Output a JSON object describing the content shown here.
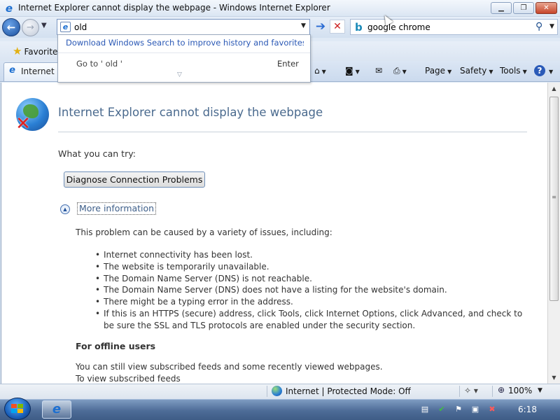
{
  "window": {
    "title": "Internet Explorer cannot display the webpage - Windows Internet Explorer",
    "min_glyph": "▁",
    "max_glyph": "❐",
    "close_glyph": "✕"
  },
  "navigation": {
    "back_glyph": "←",
    "forward_glyph": "→",
    "address_value": "old",
    "go_glyph": "➔",
    "stop_glyph": "✕",
    "search_value": "google chrome"
  },
  "suggestions": {
    "link": "Download Windows Search to improve history and favorites r...",
    "goto": "Go to ' old '",
    "enter": "Enter"
  },
  "favorites_bar": {
    "label": "Favorites"
  },
  "tab": {
    "label": "Internet Explorer cannot display the webpage"
  },
  "command_bar": {
    "page": "Page",
    "safety": "Safety",
    "tools": "Tools"
  },
  "content": {
    "title": "Internet Explorer cannot display the webpage",
    "try_label": "What you can try:",
    "diagnose_button": "Diagnose Connection Problems",
    "more_info": "More information",
    "problem_intro": "This problem can be caused by a variety of issues, including:",
    "causes": [
      "Internet connectivity has been lost.",
      "The website is temporarily unavailable.",
      "The Domain Name Server (DNS) is not reachable.",
      "The Domain Name Server (DNS) does not have a listing for the website's domain.",
      "There might be a typing error in the address.",
      "If this is an HTTPS (secure) address, click Tools, click Internet Options, click Advanced, and check to be sure the SSL and TLS protocols are enabled under the security section."
    ],
    "offline_heading": "For offline users",
    "offline_p1": "You can still view subscribed feeds and some recently viewed webpages.",
    "offline_p2": "To view subscribed feeds"
  },
  "status_bar": {
    "zone": "Internet | Protected Mode: Off",
    "zoom": "100%"
  },
  "taskbar": {
    "clock": "6:18"
  },
  "colors": {
    "title_blue": "#4a6a8e",
    "link_blue": "#2a58b5",
    "close_red": "#c7452a"
  }
}
